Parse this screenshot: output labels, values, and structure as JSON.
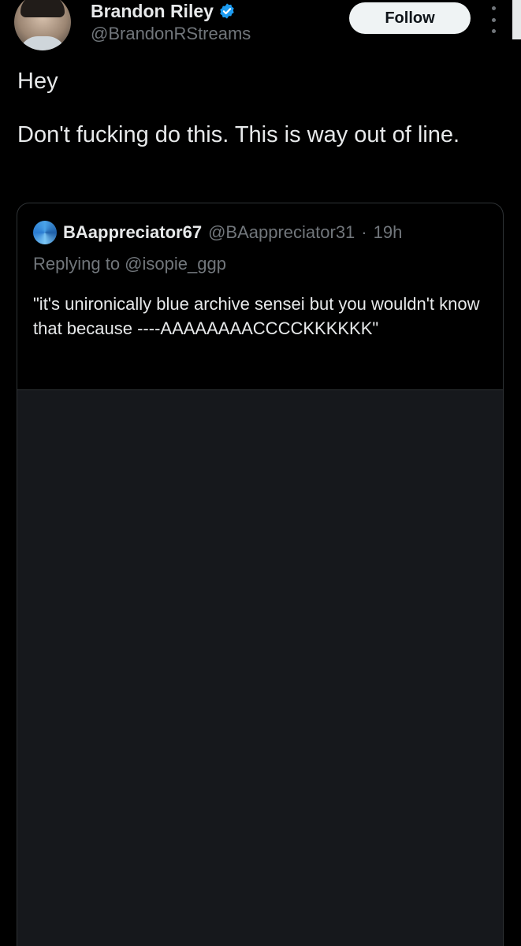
{
  "author": {
    "name": "Brandon Riley",
    "handle": "@BrandonRStreams",
    "follow_label": "Follow",
    "verified_color": "#1d9bf0"
  },
  "tweet": {
    "lines": [
      "Hey",
      "Don't fucking do this. This is way out of line."
    ]
  },
  "quote": {
    "name": "BAappreciator67",
    "handle": "@BAappreciator31",
    "separator": "·",
    "time": "19h",
    "replying_to": "Replying to @isopie_ggp",
    "text": "\"it's unironically blue archive sensei but you wouldn't know that because ----AAAAAAAACCCCKKKKKK\""
  },
  "colors": {
    "background": "#000000",
    "text": "#e7e9ea",
    "muted": "#71767b",
    "border": "#2f3336"
  }
}
